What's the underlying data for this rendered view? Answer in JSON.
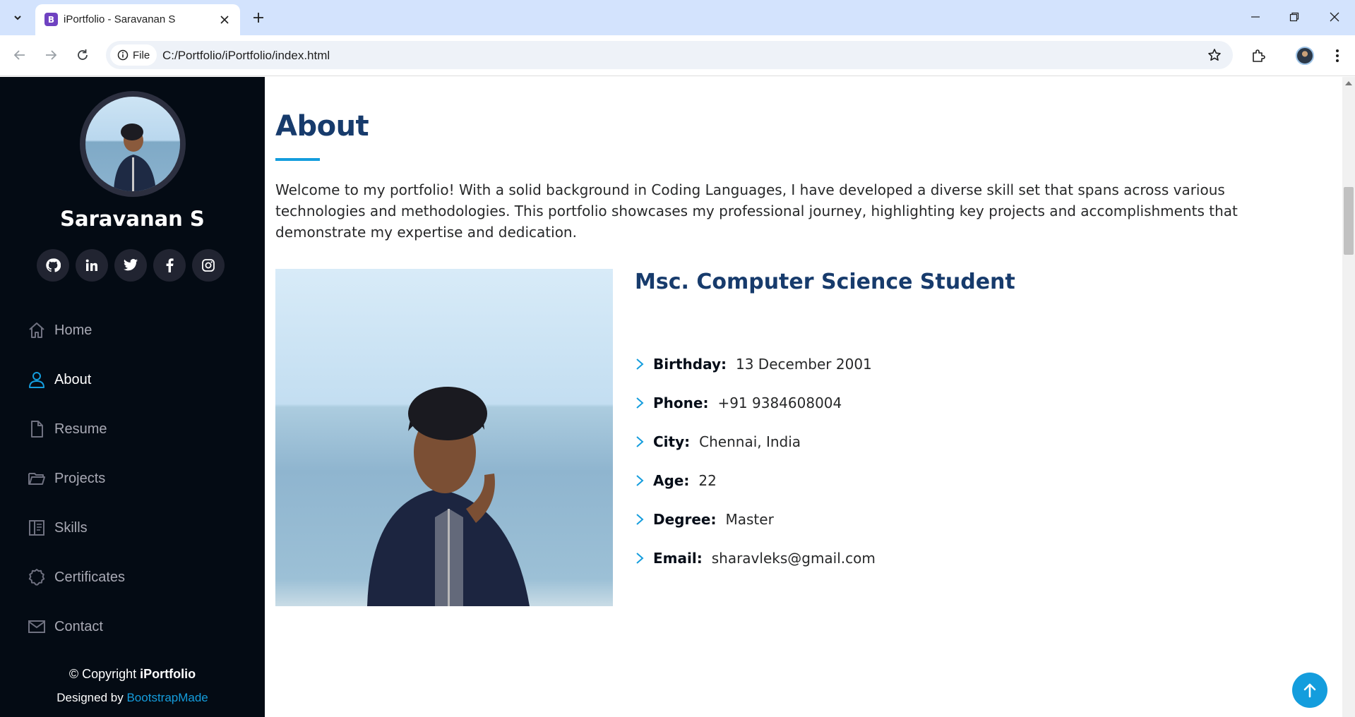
{
  "browser": {
    "tab_title": "iPortfolio - Saravanan S",
    "favicon_letter": "B",
    "site_chip_label": "File",
    "url": "C:/Portfolio/iPortfolio/index.html"
  },
  "sidebar": {
    "name": "Saravanan S",
    "social": [
      {
        "icon": "github-icon"
      },
      {
        "icon": "linkedin-icon"
      },
      {
        "icon": "twitter-icon"
      },
      {
        "icon": "facebook-icon"
      },
      {
        "icon": "instagram-icon"
      }
    ],
    "nav": [
      {
        "label": "Home",
        "icon": "home-icon"
      },
      {
        "label": "About",
        "icon": "person-icon",
        "active": true
      },
      {
        "label": "Resume",
        "icon": "file-icon"
      },
      {
        "label": "Projects",
        "icon": "folder-icon"
      },
      {
        "label": "Skills",
        "icon": "book-icon"
      },
      {
        "label": "Certificates",
        "icon": "badge-icon"
      },
      {
        "label": "Contact",
        "icon": "envelope-icon"
      }
    ],
    "copyright_prefix": "© Copyright",
    "copyright_brand": "iPortfolio",
    "credits_prefix": "Designed by",
    "credits_link": "BootstrapMade"
  },
  "about": {
    "title": "About",
    "intro": "Welcome to my portfolio! With a solid background in Coding Languages, I have developed a diverse skill set that spans across various technologies and methodologies. This portfolio showcases my professional journey, highlighting key projects and accomplishments that demonstrate my expertise and dedication.",
    "heading": "Msc. Computer Science Student",
    "details": [
      {
        "label": "Birthday:",
        "value": "13 December 2001"
      },
      {
        "label": "Phone:",
        "value": "+91 9384608004"
      },
      {
        "label": "City:",
        "value": "Chennai, India"
      },
      {
        "label": "Age:",
        "value": "22"
      },
      {
        "label": "Degree:",
        "value": "Master"
      },
      {
        "label": "Email:",
        "value": "sharavleks@gmail.com"
      }
    ]
  },
  "colors": {
    "accent": "#149ddd",
    "heading": "#173b6c",
    "sidebar_bg": "#040b14",
    "chrome_bg": "#d3e3fd"
  }
}
